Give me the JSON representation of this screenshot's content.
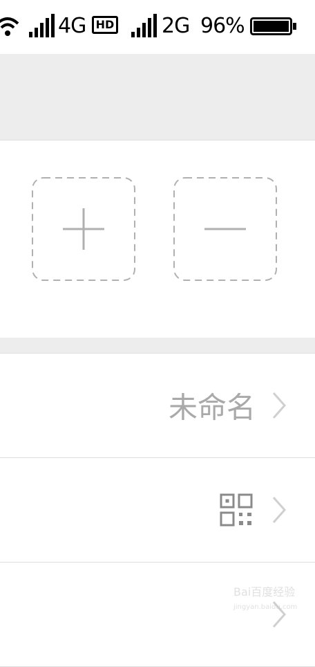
{
  "status_bar": {
    "network_1": "4G",
    "hd_badge": "HD",
    "network_2": "2G",
    "battery_percent": "96%",
    "icons": [
      "wifi-icon",
      "signal-icon",
      "hd-icon",
      "signal-icon",
      "battery-icon"
    ]
  },
  "members": {
    "add_icon": "plus-icon",
    "remove_icon": "minus-icon"
  },
  "settings": {
    "rows": [
      {
        "value": "未命名",
        "icon": "chevron-right-icon"
      },
      {
        "icon": "qr-code-icon"
      },
      {
        "icon": "chevron-right-icon"
      }
    ]
  },
  "watermark": {
    "text": "Bai百度经验",
    "url": "jingyan.baidu.com"
  },
  "colors": {
    "background": "#ffffff",
    "grey_band": "#ededed",
    "muted_text": "#a9a9a9",
    "dashed_border": "#b0b0b0"
  }
}
